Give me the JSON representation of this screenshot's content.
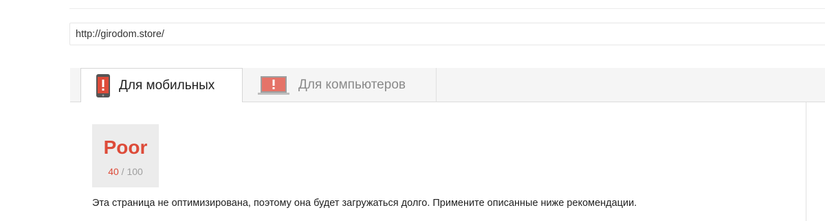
{
  "url_input": {
    "value": "http://girodom.store/"
  },
  "tabs": [
    {
      "label": "Для мобильных",
      "icon": "mobile-phone-warning-icon",
      "active": true
    },
    {
      "label": "Для компьютеров",
      "icon": "laptop-warning-icon",
      "active": false
    }
  ],
  "score": {
    "rating": "Poor",
    "value": "40",
    "separator": "/",
    "max": "100"
  },
  "summary": "Эта страница не оптимизирована, поэтому она будет загружаться долго. Примените описанные ниже рекомендации.",
  "colors": {
    "poor_red": "#dd4b39",
    "tab_bar_bg": "#f5f5f5",
    "score_box_bg": "#ececec"
  }
}
